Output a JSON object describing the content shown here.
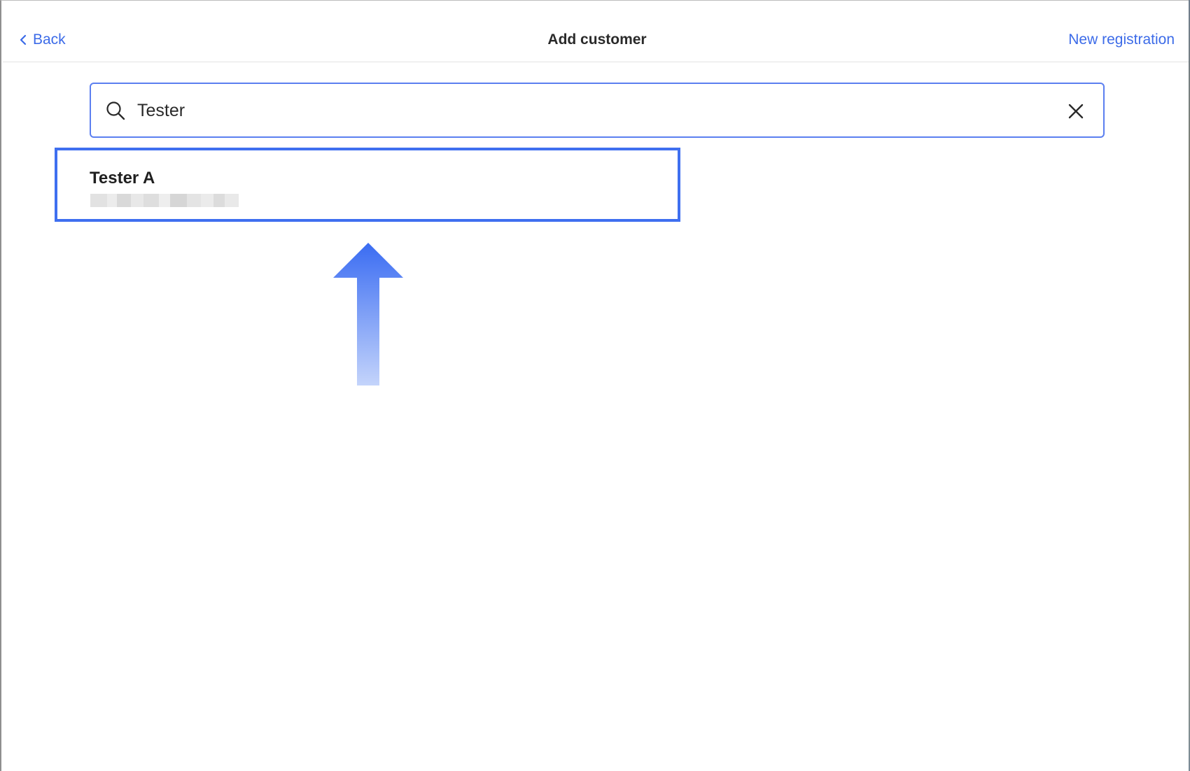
{
  "header": {
    "back_label": "Back",
    "title": "Add customer",
    "new_registration_label": "New registration"
  },
  "search": {
    "value": "Tester",
    "placeholder": ""
  },
  "results": [
    {
      "name": "Tester A",
      "detail_redacted": true
    }
  ],
  "icons": {
    "back": "chevron-left-icon",
    "search": "search-icon",
    "clear": "close-icon",
    "annotation": "arrow-up-icon"
  },
  "colors": {
    "accent": "#3c6be8",
    "search_border": "#5b7ff0",
    "highlight_border": "#3f6ff0",
    "caret": "#3fae5a",
    "title_text": "#2a2a2a"
  }
}
